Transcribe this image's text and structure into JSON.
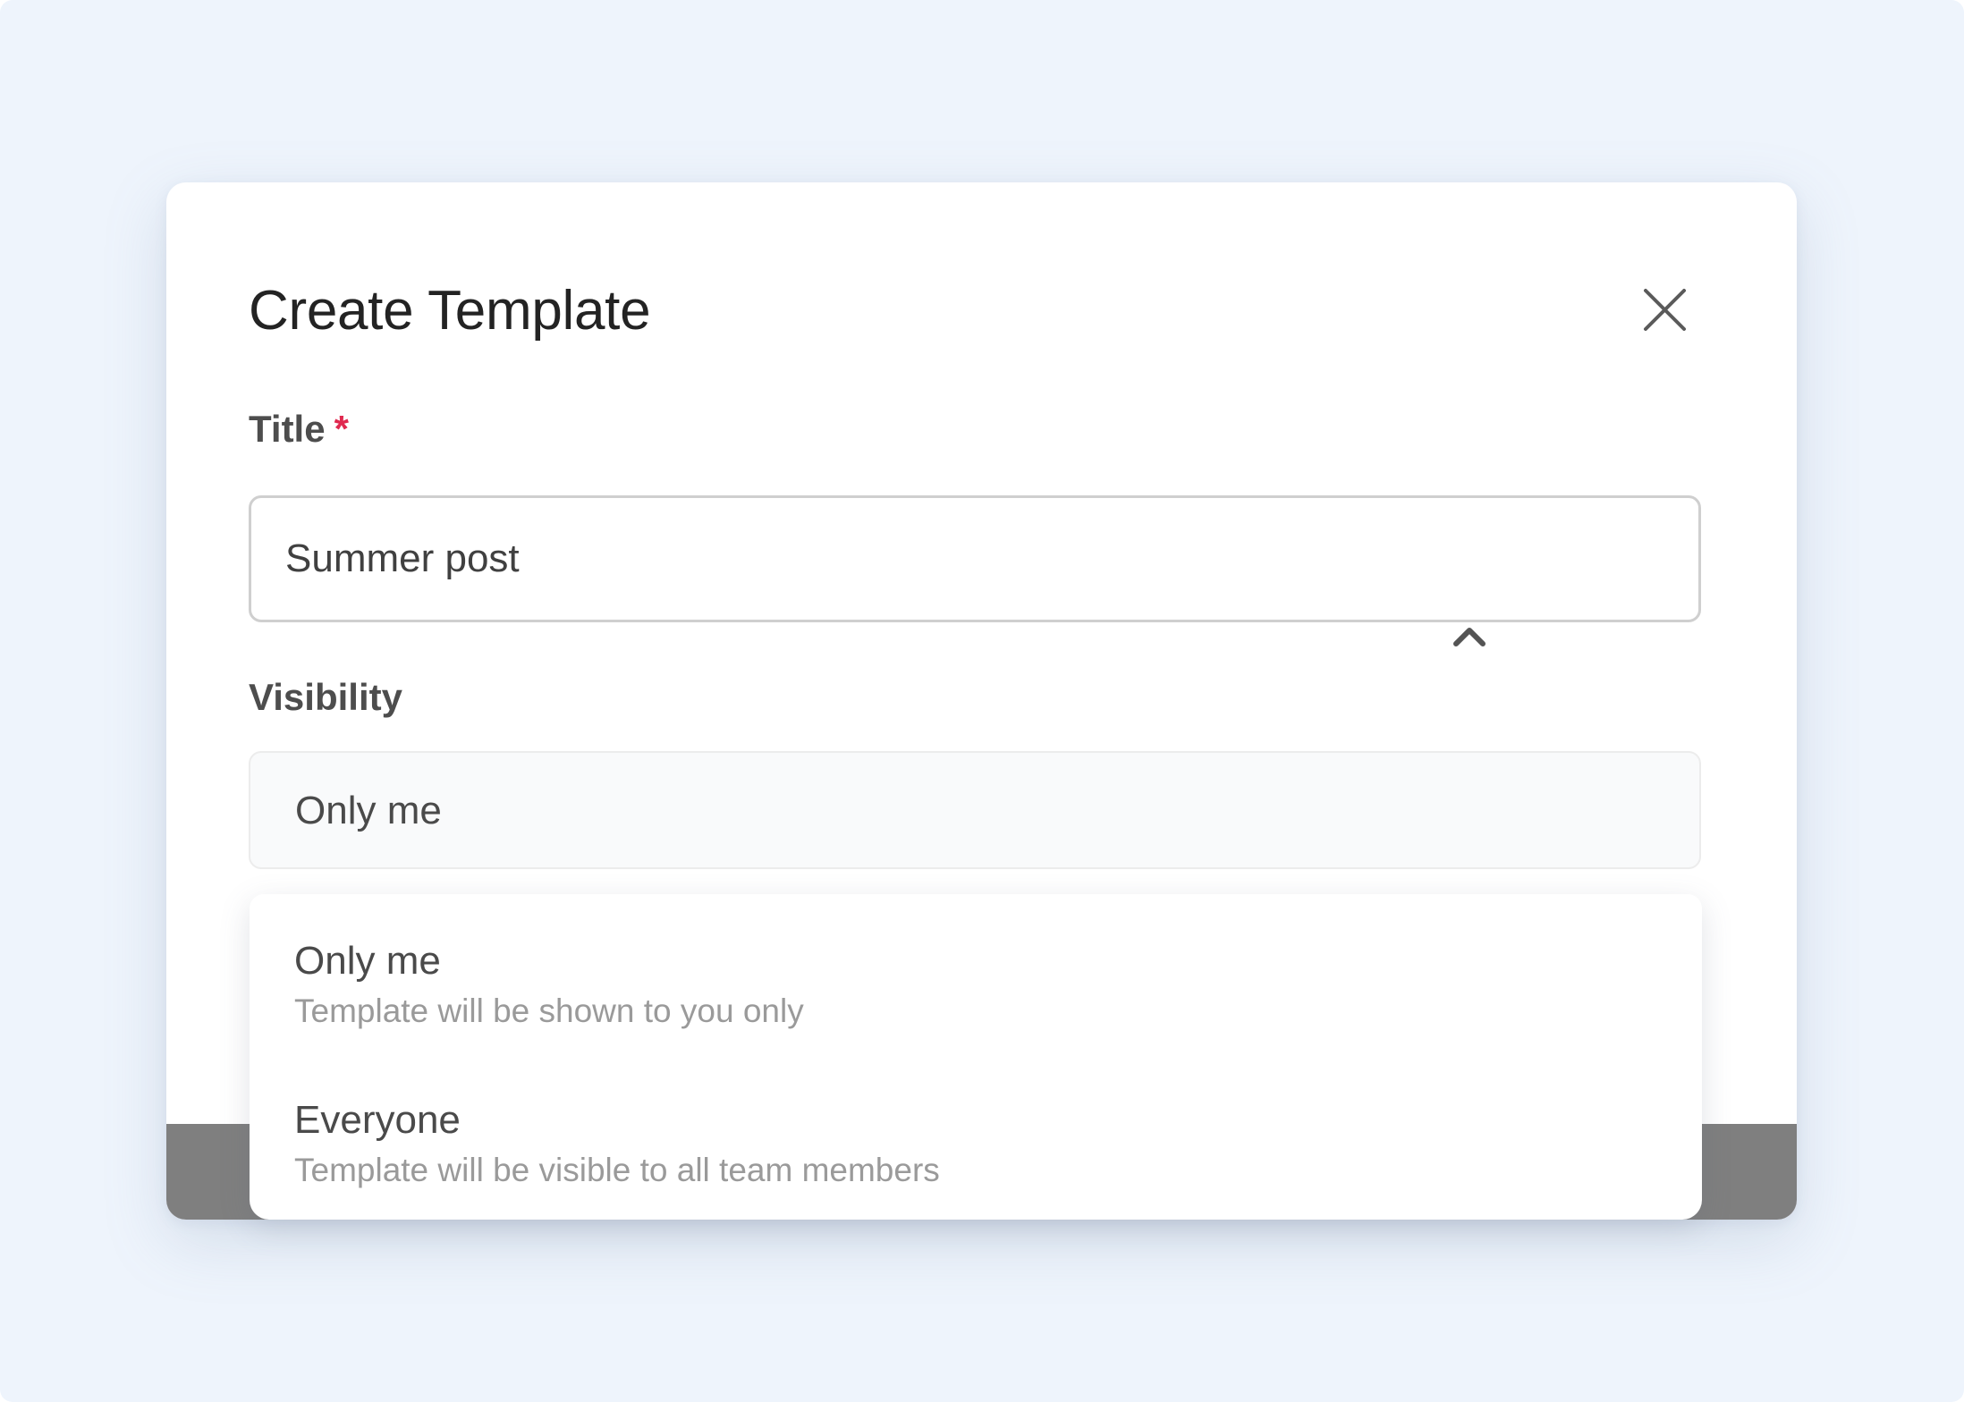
{
  "modal": {
    "title": "Create Template",
    "close_icon": "close-icon"
  },
  "fields": {
    "title": {
      "label": "Title",
      "required_marker": "*",
      "value": "Summer post"
    },
    "visibility": {
      "label": "Visibility",
      "selected": "Only me",
      "toggle_icon": "chevron-up-icon",
      "options": [
        {
          "label": "Only me",
          "description": "Template will be shown to you only"
        },
        {
          "label": "Everyone",
          "description": "Template will be visible to all team members"
        }
      ]
    }
  },
  "colors": {
    "backdrop": "#eef4fc",
    "required": "#e0294f",
    "footer_overlay": "#7f7f7f",
    "select_background": "#f9fafb"
  }
}
